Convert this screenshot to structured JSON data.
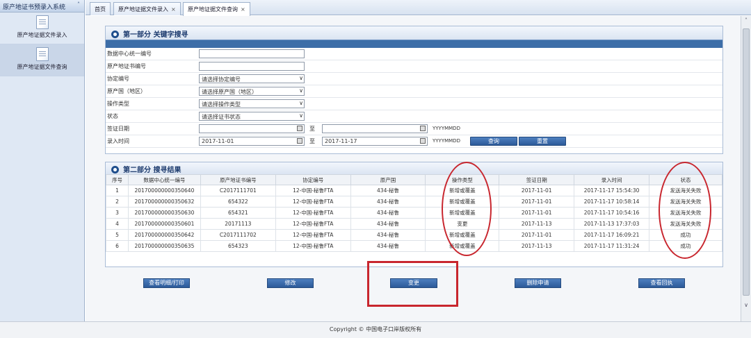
{
  "sidebar": {
    "title": "原产地证书预录入系统",
    "items": [
      {
        "label": "原产地证据文件录入"
      },
      {
        "label": "原产地证据文件查询"
      }
    ]
  },
  "tabs": [
    {
      "label": "首页"
    },
    {
      "label": "原产地证据文件录入"
    },
    {
      "label": "原产地证据文件查询"
    }
  ],
  "search": {
    "title": "第一部分 关键字搜寻",
    "fields": {
      "center_id": {
        "label": "数据中心统一编号",
        "value": ""
      },
      "cert_no": {
        "label": "原产地证书编号",
        "value": ""
      },
      "agreement": {
        "label": "协定编号",
        "value": "请选择协定编号"
      },
      "origin": {
        "label": "原产国（地区）",
        "value": "请选择原产国（地区）"
      },
      "op_type": {
        "label": "操作类型",
        "value": "请选择操作类型"
      },
      "status": {
        "label": "状态",
        "value": "请选择证书状态"
      },
      "sign_date": {
        "label": "签证日期",
        "from": "",
        "to": "",
        "format": "YYYYMMDD"
      },
      "entry_time": {
        "label": "录入时间",
        "from": "2017-11-01",
        "to": "2017-11-17",
        "format": "YYYYMMDD"
      }
    },
    "to_label": "至",
    "query_button": "查询",
    "reset_button": "重置"
  },
  "results": {
    "title": "第二部分 搜寻结果",
    "columns": [
      "序号",
      "数据中心统一编号",
      "原产地证书编号",
      "协定编号",
      "原产国",
      "操作类型",
      "签证日期",
      "录入时间",
      "状态"
    ],
    "rows": [
      [
        "1",
        "201700000000350640",
        "C2017111701",
        "12-中国-秘鲁FTA",
        "434-秘鲁",
        "新增或覆盖",
        "2017-11-01",
        "2017-11-17 15:54:30",
        "发送海关失败"
      ],
      [
        "2",
        "201700000000350632",
        "654322",
        "12-中国-秘鲁FTA",
        "434-秘鲁",
        "新增或覆盖",
        "2017-11-01",
        "2017-11-17 10:58:14",
        "发送海关失败"
      ],
      [
        "3",
        "201700000000350630",
        "654321",
        "12-中国-秘鲁FTA",
        "434-秘鲁",
        "新增或覆盖",
        "2017-11-01",
        "2017-11-17 10:54:16",
        "发送海关失败"
      ],
      [
        "4",
        "201700000000350601",
        "20171113",
        "12-中国-秘鲁FTA",
        "434-秘鲁",
        "变更",
        "2017-11-13",
        "2017-11-13 17:37:03",
        "发送海关失败"
      ],
      [
        "5",
        "201700000000350642",
        "C2017111702",
        "12-中国-秘鲁FTA",
        "434-秘鲁",
        "新增或覆盖",
        "2017-11-01",
        "2017-11-17 16:09:21",
        "成功"
      ],
      [
        "6",
        "201700000000350635",
        "654323",
        "12-中国-秘鲁FTA",
        "434-秘鲁",
        "新增或覆盖",
        "2017-11-13",
        "2017-11-17 11:31:24",
        "成功"
      ]
    ]
  },
  "actions": {
    "view_print": "查看明细/打印",
    "modify": "修改",
    "change": "变更",
    "delete": "删除申请",
    "view_receipt": "查看回执"
  },
  "footer": {
    "text": "Copyright © 中国电子口岸版权所有"
  },
  "colors": {
    "accent": "#3d6ea8",
    "button": "#2c5a99",
    "highlight": "#c8262e"
  }
}
